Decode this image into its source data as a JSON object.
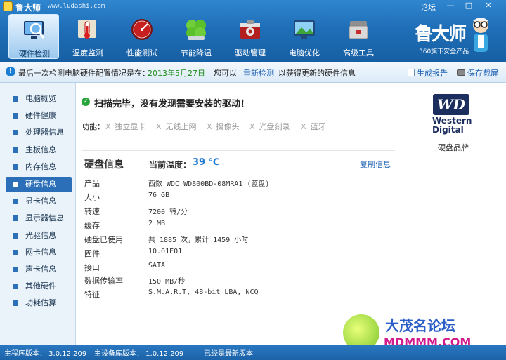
{
  "title_bar": {
    "app_name": "鲁大师",
    "url": "www.ludashi.com",
    "forum_link": "论坛",
    "min_glyph": "—",
    "restore_glyph": "□",
    "close_glyph": "✕"
  },
  "toolbar": {
    "tools": [
      {
        "label": "硬件检测",
        "icon": "monitor-magnifier-icon"
      },
      {
        "label": "温度监测",
        "icon": "thermometer-icon"
      },
      {
        "label": "性能测试",
        "icon": "speedometer-icon"
      },
      {
        "label": "节能降温",
        "icon": "clover-leaf-icon"
      },
      {
        "label": "驱动管理",
        "icon": "driver-toolbox-icon"
      },
      {
        "label": "电脑优化",
        "icon": "monitor-landscape-icon"
      },
      {
        "label": "高级工具",
        "icon": "toolbox-icon"
      }
    ],
    "active_index": 0
  },
  "brand": {
    "title": "鲁大师",
    "subtitle": "360旗下安全产品"
  },
  "info_bar": {
    "text_prefix": "最后一次检测电脑硬件配置情况是在：",
    "date": "2013年5月27日",
    "text_mid": "您可以",
    "rescan_link": "重新检测",
    "text_suffix": "以获得更新的硬件信息",
    "report_button": "生成报告",
    "screenshot_button": "保存截屏"
  },
  "sidebar": {
    "items": [
      "电脑概览",
      "硬件健康",
      "处理器信息",
      "主板信息",
      "内存信息",
      "硬盘信息",
      "显卡信息",
      "显示器信息",
      "光驱信息",
      "网卡信息",
      "声卡信息",
      "其他硬件",
      "功耗估算"
    ],
    "active_index": 5
  },
  "scan": {
    "message": "扫描完毕，没有发现需要安装的驱动！",
    "func_label": "功能：",
    "funcs": [
      "独立显卡",
      "无线上网",
      "摄像头",
      "光盘刻录",
      "蓝牙"
    ],
    "x_glyph": "X"
  },
  "disk": {
    "section_title": "硬盘信息",
    "temp_label": "当前温度：",
    "temp_value": "39 ℃",
    "copy_link": "复制信息",
    "rows": [
      {
        "k": "产品",
        "v": "西数 WDC WD800BD-08MRA1 (蓝盘)"
      },
      {
        "k": "大小",
        "v": "76 GB"
      },
      {
        "k": "转速",
        "v": "7200 转/分"
      },
      {
        "k": "缓存",
        "v": "2 MB"
      },
      {
        "k": "硬盘已使用",
        "v": "共 1885 次，累计 1459 小时"
      },
      {
        "k": "固件",
        "v": "10.01E01"
      },
      {
        "k": "接口",
        "v": "SATA"
      },
      {
        "k": "数据传输率",
        "v": "150 MB/秒"
      },
      {
        "k": "特征",
        "v": "S.M.A.R.T,  48-bit LBA,  NCQ"
      }
    ]
  },
  "brand_panel": {
    "logo": "WD",
    "name_line1": "Western",
    "name_line2": "Digital",
    "caption": "硬盘品牌"
  },
  "watermark": {
    "title": "大茂名论坛",
    "sub": "MDMMM.COM"
  },
  "status_bar": {
    "main_version": "主程序版本： 3.0.12.209",
    "db_version": "主设备库版本： 1.0.12.209",
    "latest": "已经是最新版本"
  }
}
